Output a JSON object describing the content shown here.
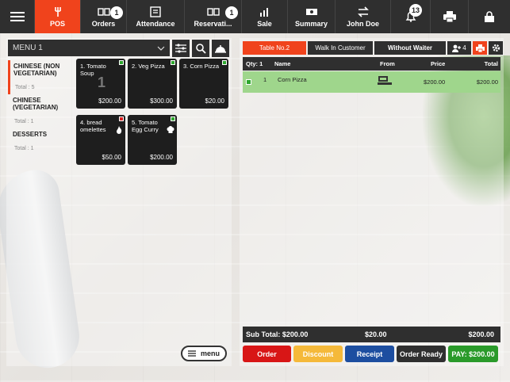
{
  "topbar": {
    "items": [
      {
        "label": "",
        "icon": "hamburger-icon"
      },
      {
        "label": "POS",
        "icon": "pos-icon",
        "active": true
      },
      {
        "label": "Orders",
        "icon": "orders-icon",
        "badge": "1"
      },
      {
        "label": "Attendance",
        "icon": "attendance-icon"
      },
      {
        "label": "Reservati...",
        "icon": "reservation-icon",
        "badge": "1"
      },
      {
        "label": "Sale",
        "icon": "chart-icon"
      },
      {
        "label": "Summary",
        "icon": "cash-icon"
      },
      {
        "label": "John Doe",
        "icon": "swap-icon"
      },
      {
        "label": "",
        "icon": "bell-icon",
        "badge": "13"
      },
      {
        "label": "",
        "icon": "printer-icon"
      },
      {
        "label": "",
        "icon": "lock-icon"
      }
    ]
  },
  "left": {
    "menu_select": "MENU 1",
    "categories": [
      {
        "name": "CHINESE (NON VEGETARIAN)",
        "total": "Total : 5",
        "active": true
      },
      {
        "name": "CHINESE (VEGETARIAN)",
        "total": "Total : 1"
      },
      {
        "name": "DESSERTS",
        "total": "Total : 1"
      }
    ],
    "items": [
      {
        "name": "1. Tomato Soup",
        "price": "$200.00",
        "qty": "1",
        "veg": true
      },
      {
        "name": "2. Veg Pizza",
        "price": "$300.00",
        "veg": true
      },
      {
        "name": "3. Corn Pizza",
        "price": "$20.00",
        "veg": true
      },
      {
        "name": "4. bread omelettes",
        "price": "$50.00",
        "veg": false,
        "extra_icon": "fire-icon"
      },
      {
        "name": "5. Tomato Egg Curry",
        "price": "$200.00",
        "veg": true,
        "extra_icon": "chef-hat-icon"
      }
    ],
    "menu_button": "menu"
  },
  "right": {
    "tabs": {
      "table": "Table No.2",
      "customer": "Walk In Customer",
      "waiter": "Without Waiter",
      "guests": "4"
    },
    "order_header": {
      "qty": "Qty: 1",
      "name": "Name",
      "from": "From",
      "price": "Price",
      "total": "Total"
    },
    "order_rows": [
      {
        "qty": "1",
        "name": "Corn Pizza",
        "price": "$200.00",
        "total": "$200.00"
      }
    ],
    "subtotal": {
      "label": "Sub Total: $200.00",
      "mid": "$20.00",
      "right": "$200.00"
    },
    "actions": {
      "order": "Order",
      "discount": "Discount",
      "receipt": "Receipt",
      "order_ready": "Order Ready",
      "pay": "PAY: $200.00"
    }
  },
  "colors": {
    "accent": "#f0431c",
    "dark": "#2f2f2f",
    "order": "#d81616",
    "discount": "#f5b93a",
    "receipt": "#1d4ea0",
    "pay": "#2a9a2a",
    "row_selected": "#9fd68c"
  }
}
